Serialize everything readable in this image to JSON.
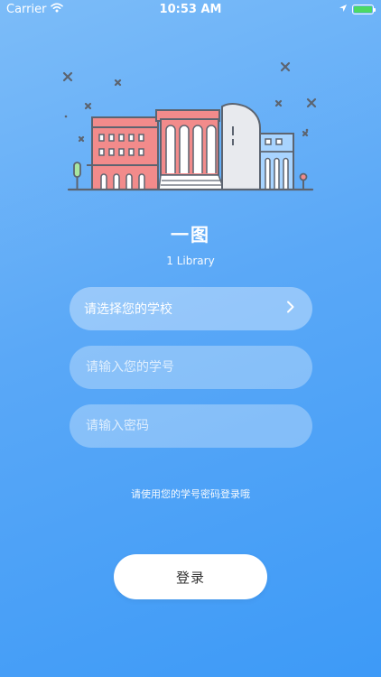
{
  "status_bar": {
    "carrier": "Carrier",
    "time": "10:53 AM",
    "battery_level": 1.0
  },
  "app": {
    "title": "一图",
    "subtitle": "1 Library"
  },
  "form": {
    "school_select_label": "请选择您的学校",
    "student_id_placeholder": "请输入您的学号",
    "password_placeholder": "请输入密码",
    "hint": "请使用您的学号密码登录哦",
    "login_label": "登录"
  },
  "colors": {
    "background_top": "#7cbcf8",
    "background_bottom": "#3d9af7",
    "building_red": "#f28b8b",
    "building_blue": "#a8d4ff",
    "outline": "#5c6470"
  },
  "icons": [
    "wifi-icon",
    "battery-icon",
    "library-illustration",
    "chevron-right-icon"
  ]
}
